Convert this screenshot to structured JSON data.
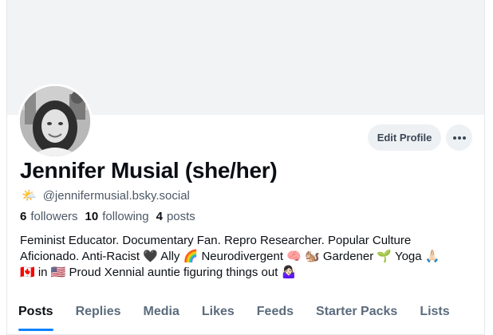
{
  "profile": {
    "display_name": "Jennifer Musial (she/her)",
    "handle_emoji": "🌤️",
    "handle": "@jennifermusial.bsky.social",
    "bio": "Feminist Educator. Documentary Fan. Repro Researcher. Popular Culture\nAficionado. Anti-Racist 🖤 Ally 🌈 Neurodivergent 🧠 🐿️ Gardener 🌱 Yoga 🙏🏻\n🇨🇦 in 🇺🇸 Proud Xennial auntie figuring things out 🤷🏻‍♀️"
  },
  "stats": {
    "followers_count": "6",
    "followers_label": "followers",
    "following_count": "10",
    "following_label": "following",
    "posts_count": "4",
    "posts_label": "posts"
  },
  "actions": {
    "edit_profile": "Edit Profile",
    "more": "···"
  },
  "tabs": [
    {
      "label": "Posts",
      "active": true
    },
    {
      "label": "Replies",
      "active": false
    },
    {
      "label": "Media",
      "active": false
    },
    {
      "label": "Likes",
      "active": false
    },
    {
      "label": "Feeds",
      "active": false
    },
    {
      "label": "Starter Packs",
      "active": false
    },
    {
      "label": "Lists",
      "active": false
    }
  ],
  "colors": {
    "accent": "#1083fe",
    "banner": "#f1f3f5",
    "button_bg": "#eef1f4",
    "muted_text": "#4c5866"
  },
  "icons": {
    "more": "ellipsis-icon",
    "handle": "sun-behind-cloud-icon"
  }
}
